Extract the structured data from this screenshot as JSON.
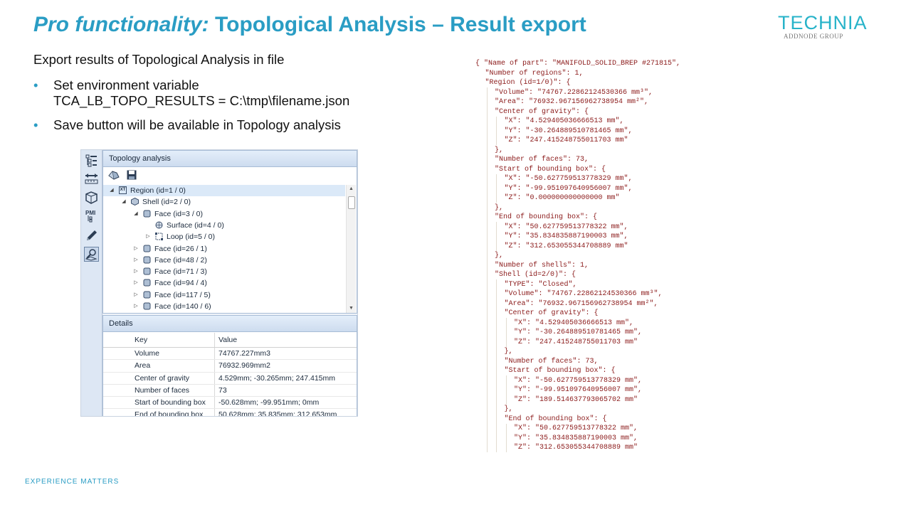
{
  "slide": {
    "title_italic": "Pro functionality:",
    "title_main": "Topological Analysis – Result export",
    "logo_word": "TECHNIA",
    "logo_sub": "ADDNODE GROUP",
    "intro": "Export results of Topological Analysis in file",
    "bullets": [
      {
        "line1": "Set environment variable",
        "line2": "TCA_LB_TOPO_RESULTS  = C:\\tmp\\filename.json"
      },
      {
        "line1": "Save button will be available in Topology analysis",
        "line2": ""
      }
    ],
    "bullet_glyph": "•",
    "footer": "EXPERIENCE MATTERS",
    "accent_color": "#2a9dc4"
  },
  "app": {
    "rail_icons": [
      "structure-tree-icon",
      "measure-icon",
      "part-icon",
      "pmi-icon",
      "pencil-icon",
      "topology-analysis-icon"
    ],
    "rail_pmi_text": "PMI",
    "panel_title": "Topology analysis",
    "toolbar_icons": [
      "analyze-icon",
      "save-icon"
    ],
    "tree": [
      {
        "label": "Region (id=1 / 0)",
        "level": 0,
        "toggle": "◢",
        "icon": "region-icon",
        "icon_text": "XT",
        "selected": true
      },
      {
        "label": "Shell (id=2 / 0)",
        "level": 1,
        "toggle": "◢",
        "icon": "shell-icon",
        "icon_text": "",
        "selected": false
      },
      {
        "label": "Face (id=3 / 0)",
        "level": 2,
        "toggle": "◢",
        "icon": "face-icon",
        "icon_text": "",
        "selected": false
      },
      {
        "label": "Surface (id=4 / 0)",
        "level": 3,
        "toggle": "",
        "icon": "surface-icon",
        "icon_text": "",
        "selected": false
      },
      {
        "label": "Loop (id=5 / 0)",
        "level": 3,
        "toggle": "▷",
        "icon": "loop-icon",
        "icon_text": "",
        "selected": false
      },
      {
        "label": "Face (id=26 / 1)",
        "level": 2,
        "toggle": "▷",
        "icon": "face-icon",
        "icon_text": "",
        "selected": false
      },
      {
        "label": "Face (id=48 / 2)",
        "level": 2,
        "toggle": "▷",
        "icon": "face-icon",
        "icon_text": "",
        "selected": false
      },
      {
        "label": "Face (id=71 / 3)",
        "level": 2,
        "toggle": "▷",
        "icon": "face-icon",
        "icon_text": "",
        "selected": false
      },
      {
        "label": "Face (id=94 / 4)",
        "level": 2,
        "toggle": "▷",
        "icon": "face-icon",
        "icon_text": "",
        "selected": false
      },
      {
        "label": "Face (id=117 / 5)",
        "level": 2,
        "toggle": "▷",
        "icon": "face-icon",
        "icon_text": "",
        "selected": false
      },
      {
        "label": "Face (id=140 / 6)",
        "level": 2,
        "toggle": "▷",
        "icon": "face-icon",
        "icon_text": "",
        "selected": false
      }
    ],
    "scroll_up": "▲",
    "scroll_down": "▼",
    "details_title": "Details",
    "details_columns": {
      "key": "Key",
      "value": "Value"
    },
    "details_rows": [
      {
        "key": "Volume",
        "value": "74767.227mm3"
      },
      {
        "key": "Area",
        "value": "76932.969mm2"
      },
      {
        "key": "Center of gravity",
        "value": "4.529mm; -30.265mm; 247.415mm"
      },
      {
        "key": "Number of faces",
        "value": "73"
      },
      {
        "key": "Start of bounding box",
        "value": "-50.628mm; -99.951mm; 0mm"
      },
      {
        "key": "End of bounding box",
        "value": "50.628mm; 35.835mm; 312.653mm"
      }
    ]
  },
  "json_lines": [
    {
      "t": "{ \"Name of part\": \"MANIFOLD_SOLID_BREP #271815\",",
      "i": 0
    },
    {
      "t": "\"Number of regions\": 1,",
      "i": 1
    },
    {
      "t": "\"Region (id=1/0)\": {",
      "i": 1
    },
    {
      "t": "\"Volume\": \"74767.22862124530366 mm³\",",
      "i": 2
    },
    {
      "t": "\"Area\": \"76932.967156962738954 mm²\",",
      "i": 2
    },
    {
      "t": "\"Center of gravity\": {",
      "i": 2
    },
    {
      "t": "\"X\": \"4.529405036666513 mm\",",
      "i": 3
    },
    {
      "t": "\"Y\": \"-30.264889510781465 mm\",",
      "i": 3
    },
    {
      "t": "\"Z\": \"247.415248755011703 mm\"",
      "i": 3
    },
    {
      "t": "},",
      "i": 2
    },
    {
      "t": "\"Number of faces\": 73,",
      "i": 2
    },
    {
      "t": "\"Start of bounding box\": {",
      "i": 2
    },
    {
      "t": "\"X\": \"-50.627759513778329 mm\",",
      "i": 3
    },
    {
      "t": "\"Y\": \"-99.951097640956007 mm\",",
      "i": 3
    },
    {
      "t": "\"Z\": \"0.000000000000000 mm\"",
      "i": 3
    },
    {
      "t": "},",
      "i": 2
    },
    {
      "t": "\"End of bounding box\": {",
      "i": 2
    },
    {
      "t": "\"X\": \"50.627759513778322 mm\",",
      "i": 3
    },
    {
      "t": "\"Y\": \"35.834835887190003 mm\",",
      "i": 3
    },
    {
      "t": "\"Z\": \"312.653055344708889 mm\"",
      "i": 3
    },
    {
      "t": "},",
      "i": 2
    },
    {
      "t": "\"Number of shells\": 1,",
      "i": 2
    },
    {
      "t": "\"Shell (id=2/0)\": {",
      "i": 2
    },
    {
      "t": "\"TYPE\": \"Closed\",",
      "i": 3
    },
    {
      "t": "\"Volume\": \"74767.22862124530366 mm³\",",
      "i": 3
    },
    {
      "t": "\"Area\": \"76932.967156962738954 mm²\",",
      "i": 3
    },
    {
      "t": "\"Center of gravity\": {",
      "i": 3
    },
    {
      "t": "\"X\": \"4.529405036666513 mm\",",
      "i": 4
    },
    {
      "t": "\"Y\": \"-30.264889510781465 mm\",",
      "i": 4
    },
    {
      "t": "\"Z\": \"247.415248755011703 mm\"",
      "i": 4
    },
    {
      "t": "},",
      "i": 3
    },
    {
      "t": "\"Number of faces\": 73,",
      "i": 3
    },
    {
      "t": "\"Start of bounding box\": {",
      "i": 3
    },
    {
      "t": "\"X\": \"-50.627759513778329 mm\",",
      "i": 4
    },
    {
      "t": "\"Y\": \"-99.951097640956007 mm\",",
      "i": 4
    },
    {
      "t": "\"Z\": \"189.514637793065702 mm\"",
      "i": 4
    },
    {
      "t": "},",
      "i": 3
    },
    {
      "t": "\"End of bounding box\": {",
      "i": 3
    },
    {
      "t": "\"X\": \"50.627759513778322 mm\",",
      "i": 4
    },
    {
      "t": "\"Y\": \"35.834835887190003 mm\",",
      "i": 4
    },
    {
      "t": "\"Z\": \"312.653055344708889 mm\"",
      "i": 4
    }
  ]
}
